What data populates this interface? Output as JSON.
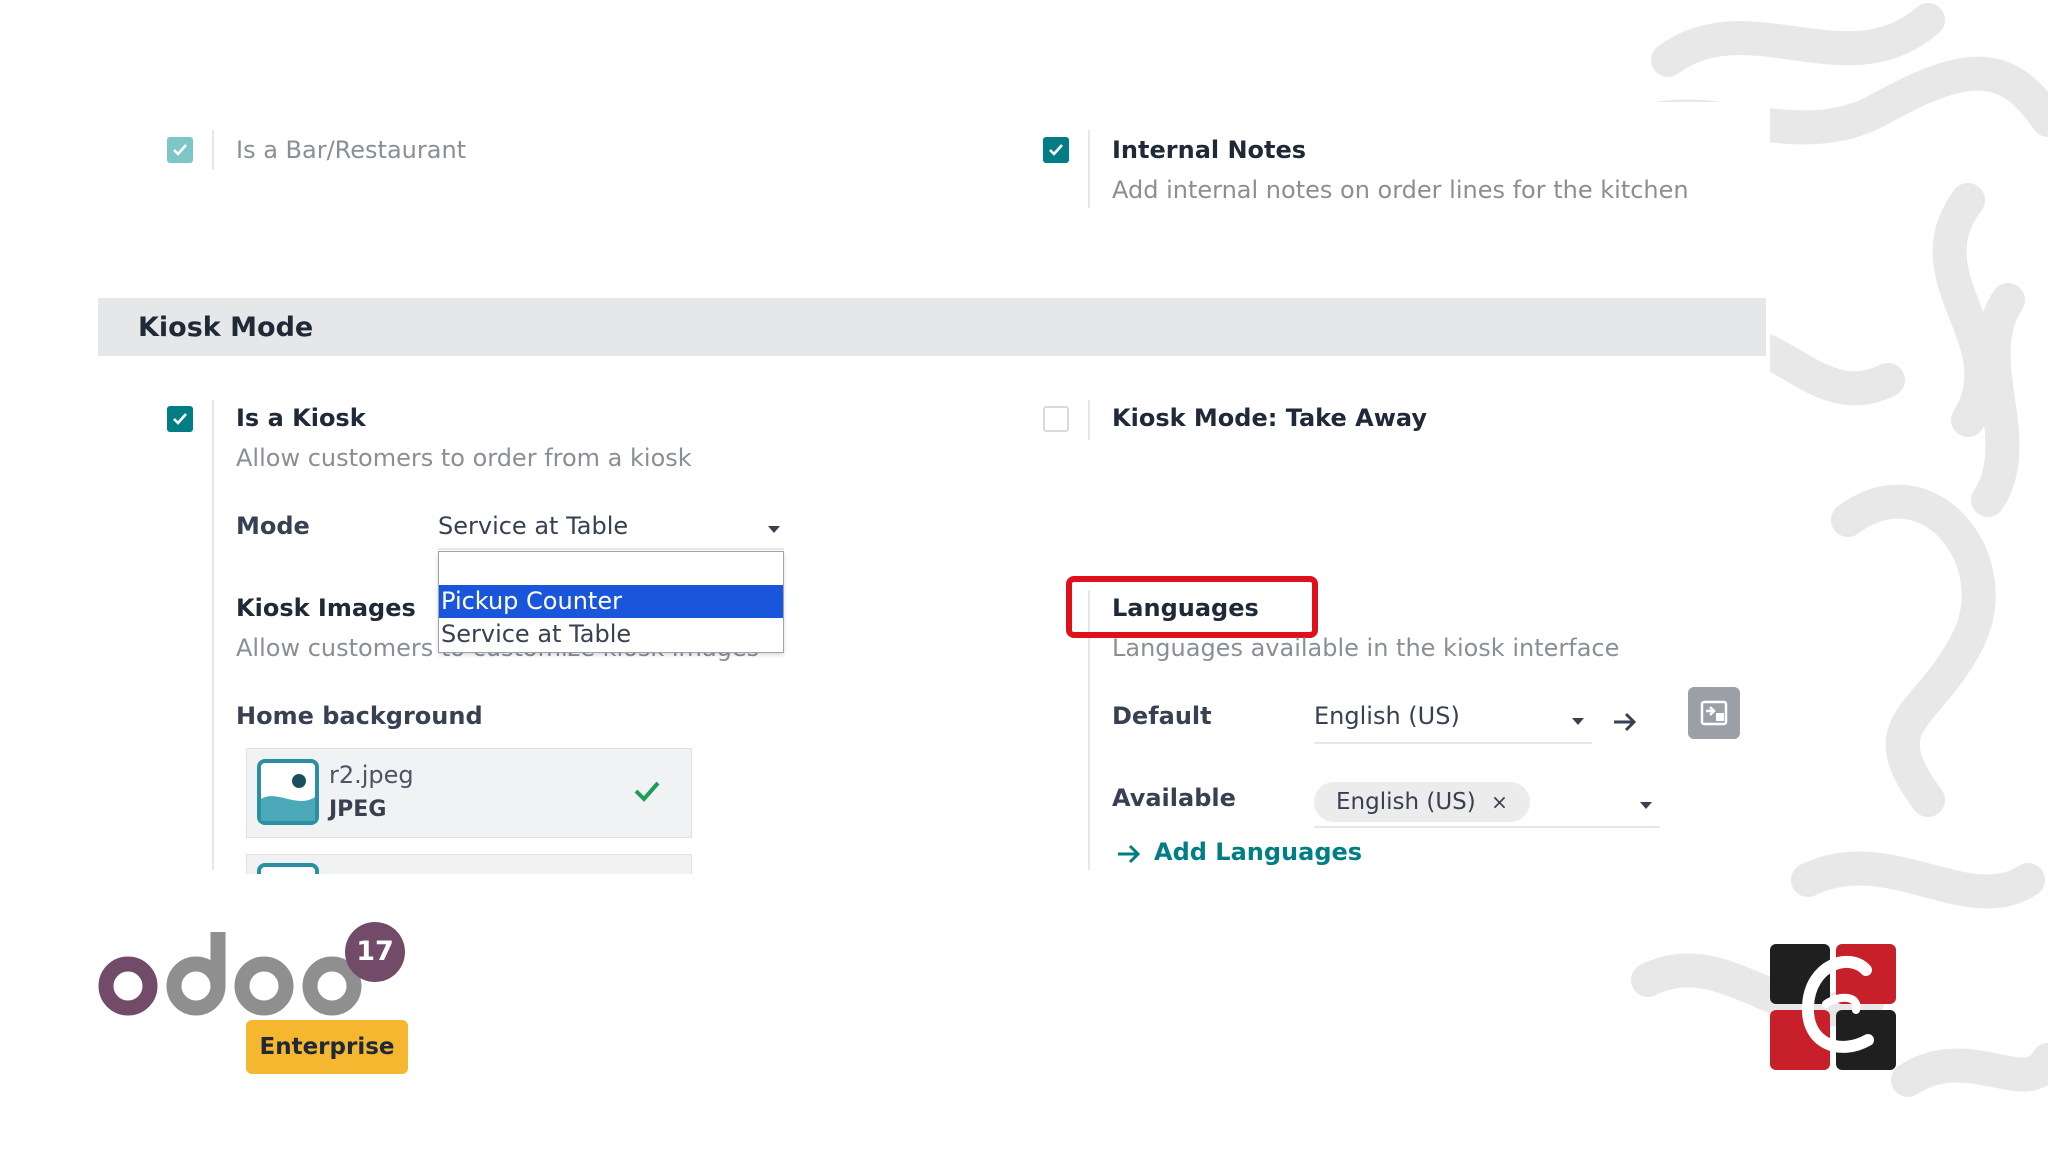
{
  "restaurant": {
    "is_bar_label": "Is a Bar/Restaurant",
    "internal_notes_label": "Internal Notes",
    "internal_notes_desc": "Add internal notes on order lines for the kitchen"
  },
  "kiosk_section": {
    "title": "Kiosk Mode",
    "is_kiosk_label": "Is a Kiosk",
    "is_kiosk_desc": "Allow customers to order from a kiosk",
    "take_away_label": "Kiosk Mode: Take Away",
    "mode_label": "Mode",
    "mode_value": "Service at Table",
    "mode_options": [
      "Pickup Counter",
      "Service at Table"
    ],
    "kiosk_images_label": "Kiosk Images",
    "kiosk_images_desc": "Allow customers to customize kiosk images",
    "home_background_label": "Home background",
    "file_name": "r2.jpeg",
    "file_type": "JPEG"
  },
  "languages": {
    "label": "Languages",
    "desc": "Languages available in the kiosk interface",
    "default_label": "Default",
    "default_value": "English (US)",
    "available_label": "Available",
    "available_tag": "English (US)",
    "add_link": "Add Languages"
  },
  "branding": {
    "version": "17",
    "edition": "Enterprise"
  },
  "colors": {
    "accent": "#017e84",
    "highlight": "#e0101a",
    "odoo_purple": "#714b67",
    "enterprise_yellow": "#f5b730"
  }
}
